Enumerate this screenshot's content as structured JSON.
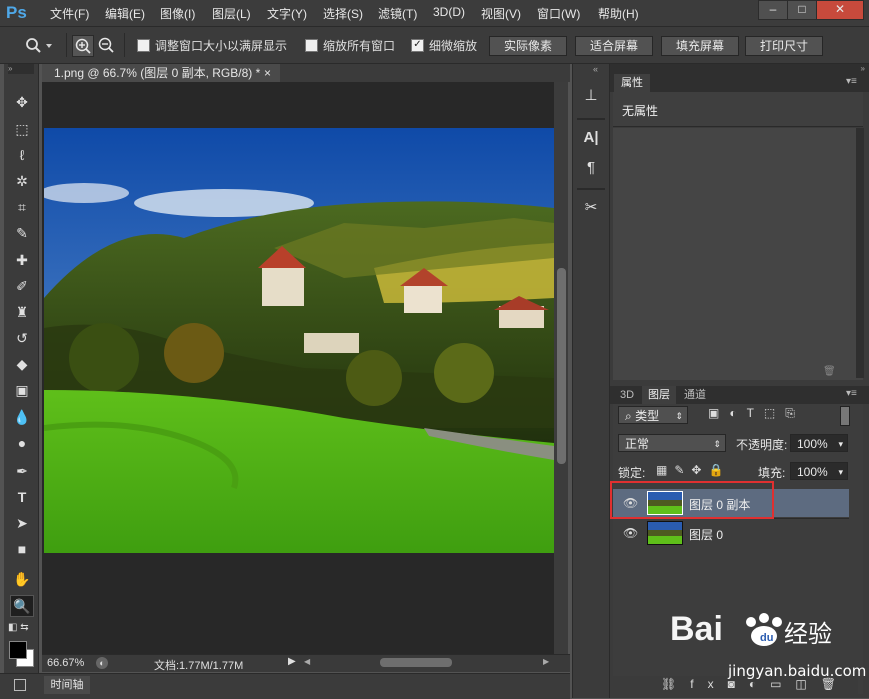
{
  "app": {
    "logo": "Ps"
  },
  "menu": {
    "items": [
      "文件(F)",
      "编辑(E)",
      "图像(I)",
      "图层(L)",
      "文字(Y)",
      "选择(S)",
      "滤镜(T)",
      "3D(D)",
      "视图(V)",
      "窗口(W)",
      "帮助(H)"
    ]
  },
  "window_controls": {
    "minimize": "–",
    "maximize": "□",
    "close": "✕"
  },
  "options": {
    "resize_windows_label": "调整窗口大小以满屏显示",
    "zoom_all_label": "缩放所有窗口",
    "scrubby_label": "细微缩放",
    "scrubby_checked": "✓",
    "actual_pixels": "实际像素",
    "fit_screen": "适合屏幕",
    "fill_screen": "填充屏幕",
    "print_size": "打印尺寸"
  },
  "document": {
    "tab_title": "1.png @ 66.7% (图层 0 副本, RGB/8) *",
    "tab_close": "×"
  },
  "status": {
    "zoom": "66.67%",
    "doc_size": "文档:1.77M/1.77M"
  },
  "timeline": {
    "label": "时间轴"
  },
  "properties": {
    "tab_label": "属性",
    "empty_text": "无属性"
  },
  "layers_panel": {
    "tabs": [
      "3D",
      "图层",
      "通道"
    ],
    "filter_label": "类型",
    "blend_mode": "正常",
    "opacity_label": "不透明度:",
    "opacity_value": "100%",
    "lock_label": "锁定:",
    "fill_label": "填充:",
    "fill_value": "100%",
    "layers": [
      {
        "name": "图层 0 副本",
        "selected": true
      },
      {
        "name": "图层 0",
        "selected": false
      }
    ]
  },
  "watermark": {
    "brand": "Bai du 经验",
    "url": "jingyan.baidu.com"
  },
  "colors": {
    "highlight_box": "#e03030",
    "selected_layer": "#5d6b80",
    "ps_blue": "#4fa8e8"
  }
}
